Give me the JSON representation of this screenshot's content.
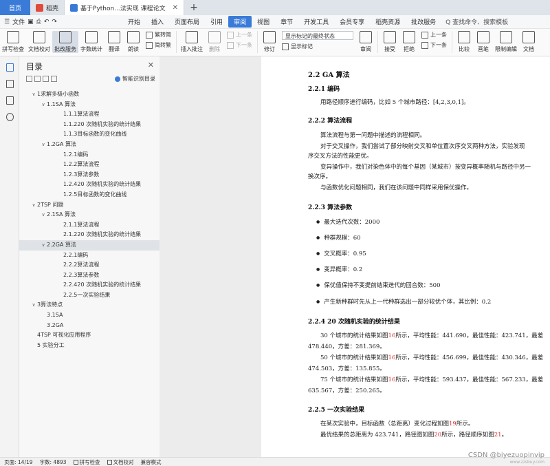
{
  "titlebar": {
    "home": "首页",
    "tabs": [
      {
        "label": "稻壳",
        "close": ""
      },
      {
        "label": "基于Python...法实现 课程论文",
        "close": "✕"
      }
    ],
    "add": "+"
  },
  "menubar": {
    "file": "文件",
    "items": [
      "开始",
      "插入",
      "页面布局",
      "引用",
      "审阅",
      "视图",
      "章节",
      "开发工具",
      "会员专享",
      "稻壳资源",
      "批改服务"
    ],
    "active_index": 4,
    "search": "Q 查找命令、搜索模板"
  },
  "ribbon": {
    "spellcheck": "拼写检查",
    "compare": "文档校对",
    "review_service": "批改服务",
    "word_count": "字数统计",
    "translate": "翻译",
    "read_aloud": "朗读",
    "simp_trad": "繁转简",
    "trad_simp": "简转繁",
    "insert_comment": "插入批注",
    "delete": "删除",
    "prev": "上一条",
    "next": "下一条",
    "track_changes": "修订",
    "show_state": "显示标记的最终状态",
    "show_markup": "显示标记",
    "review_pane": "审阅",
    "accept": "接受",
    "reject": "拒绝",
    "prev2": "上一条",
    "next2": "下一条",
    "compare2": "比较",
    "ink": "画笔",
    "restrict": "限制编辑",
    "doc_perm": "文档"
  },
  "toc": {
    "title": "目录",
    "close": "✕",
    "smart": "智能识别目录",
    "items": [
      {
        "level": 1,
        "toggle": "∨",
        "text": "1求解多极小函数"
      },
      {
        "level": 2,
        "toggle": "∨",
        "text": "1.1SA 算法"
      },
      {
        "level": 3,
        "toggle": "",
        "text": "1.1.1算法流程"
      },
      {
        "level": 3,
        "toggle": "",
        "text": "1.1.220 次随机实验的统计结果"
      },
      {
        "level": 3,
        "toggle": "",
        "text": "1.1.3目标函数的变化曲线"
      },
      {
        "level": 2,
        "toggle": "∨",
        "text": "1.2GA 算法"
      },
      {
        "level": 3,
        "toggle": "",
        "text": "1.2.1编码"
      },
      {
        "level": 3,
        "toggle": "",
        "text": "1.2.2算法流程"
      },
      {
        "level": 3,
        "toggle": "",
        "text": "1.2.3算法参数"
      },
      {
        "level": 3,
        "toggle": "",
        "text": "1.2.420 次随机实验的统计结果"
      },
      {
        "level": 3,
        "toggle": "",
        "text": "1.2.5目标函数的变化曲线"
      },
      {
        "level": 1,
        "toggle": "∨",
        "text": "2TSP 问题"
      },
      {
        "level": 2,
        "toggle": "∨",
        "text": "2.1SA 算法"
      },
      {
        "level": 3,
        "toggle": "",
        "text": "2.1.1算法流程"
      },
      {
        "level": 3,
        "toggle": "",
        "text": "2.1.220 次随机实验的统计结果"
      },
      {
        "level": 2,
        "toggle": "∨",
        "text": "2.2GA 算法",
        "selected": true
      },
      {
        "level": 3,
        "toggle": "",
        "text": "2.2.1编码"
      },
      {
        "level": 3,
        "toggle": "",
        "text": "2.2.2算法流程"
      },
      {
        "level": 3,
        "toggle": "",
        "text": "2.2.3算法参数"
      },
      {
        "level": 3,
        "toggle": "",
        "text": "2.2.420 次随机实验的统计结果"
      },
      {
        "level": 3,
        "toggle": "",
        "text": "2.2.5一次实验结果"
      },
      {
        "level": 1,
        "toggle": "∨",
        "text": "3算法特点"
      },
      {
        "level": 2,
        "toggle": "",
        "text": "3.1SA"
      },
      {
        "level": 2,
        "toggle": "",
        "text": "3.2GA"
      },
      {
        "level": 1,
        "toggle": "",
        "text": "4TSP 可视化应用程序"
      },
      {
        "level": 1,
        "toggle": "",
        "text": "5 实验分工"
      }
    ]
  },
  "doc": {
    "h_22": "2.2   GA 算法",
    "h_221": "2.2.1   编码",
    "p_221": "用路径顺序进行编码，比如 5 个城市路径：[4,2,3,0,1]。",
    "h_222": "2.2.2   算法流程",
    "p_222a": "算法流程与第一问题中描述的流程相同。",
    "p_222b": "对于交叉操作，我们尝试了部分映射交叉和单位置次序交叉两种方法，实验发现",
    "p_222c": "序交叉方法的性能更优。",
    "p_222d": "变异操作中，我们对染色体中的每个基因（某城市）按变异概率随机与路径中另一",
    "p_222e": "换次序。",
    "p_222f": "与函数优化问题相同，我们在该问题中同样采用保优操作。",
    "h_223": "2.2.3   算法参数",
    "b1": "最大迭代次数：2000",
    "b2": "种群规模：60",
    "b3": "交叉概率：0.95",
    "b4": "变异概率：0.2",
    "b5": "保优值保持不变提前结束迭代的回合数：500",
    "b6": "产生新种群时先从上一代种群选出一部分较优个体，其比例：0.2",
    "h_224": "2.2.4   20 次随机实验的统计结果",
    "p30a_1": "30 个城市的统计结果如图",
    "p30a_r": "16",
    "p30a_2": "所示，平均性能：441.690，最佳性能：423.741，最差",
    "p30b": "478.440，方差：281.369。",
    "p50a_1": "50 个城市的统计结果如图",
    "p50a_r": "16",
    "p50a_2": "所示，平均性能：456.699，最佳性能：430.346，最差",
    "p50b": "474.503，方差：135.855。",
    "p75a_1": "75 个城市的统计结果如图",
    "p75a_r": "16",
    "p75a_2": "所示，平均性能：593.437，最佳性能：567.233，最差",
    "p75b": "635.567，方差：250.265。",
    "h_225": "2.2.5   一次实验结果",
    "p225a_1": "在某次实验中，目标函数（总距离）变化过程如图",
    "p225a_r": "19",
    "p225a_2": "所示。",
    "p225b_1": "最优结果的总距离为  423.741，路径图如图",
    "p225b_r1": "20",
    "p225b_2": "所示，路径顺序如图",
    "p225b_r2": "21",
    "p225b_3": "。"
  },
  "status": {
    "page": "页面: 14/19",
    "words": "字数: 4893",
    "spell": "拼写检查",
    "proof": "文档校对",
    "compat": "兼容模式"
  },
  "watermark": "CSDN @biyezuopinvip",
  "watermark_small": "www.zzsbuy.com"
}
